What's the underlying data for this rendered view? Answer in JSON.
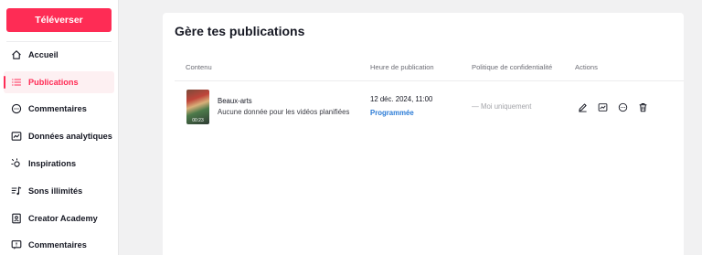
{
  "sidebar": {
    "upload_label": "Téléverser",
    "items": [
      {
        "label": "Accueil",
        "icon": "home-icon"
      },
      {
        "label": "Publications",
        "icon": "list-icon",
        "active": true
      },
      {
        "label": "Commentaires",
        "icon": "comment-icon"
      },
      {
        "label": "Données analytiques",
        "icon": "analytics-icon"
      },
      {
        "label": "Inspirations",
        "icon": "lightbulb-icon"
      },
      {
        "label": "Sons illimités",
        "icon": "music-icon"
      },
      {
        "label": "Creator Academy",
        "icon": "academy-icon"
      },
      {
        "label": "Commentaires",
        "icon": "feedback-icon"
      }
    ]
  },
  "main": {
    "title": "Gère tes publications",
    "columns": {
      "content": "Contenu",
      "time": "Heure de publication",
      "privacy": "Politique de confidentialité",
      "actions": "Actions"
    },
    "rows": [
      {
        "thumb_duration": "00:23",
        "video_title": "Beaux-arts",
        "description": "Aucune donnée pour les vidéos planifiées",
        "publish_time": "12 déc. 2024, 11:00",
        "status": "Programmée",
        "privacy": "— Moi uniquement"
      }
    ]
  },
  "colors": {
    "accent": "#fe2c55",
    "status_blue": "#2a7bd6",
    "background": "#f1f1f2"
  }
}
